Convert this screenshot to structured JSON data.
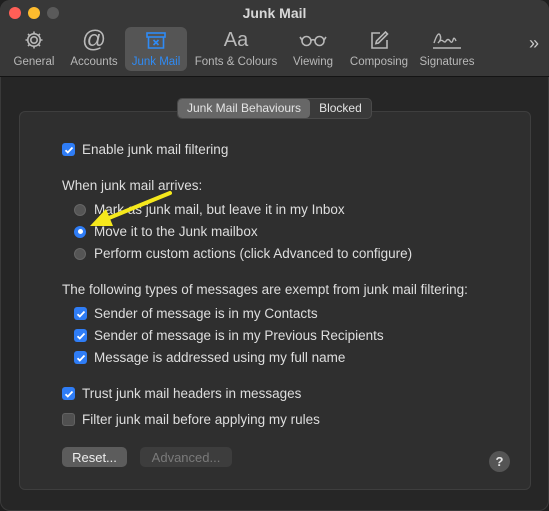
{
  "window": {
    "title": "Junk Mail"
  },
  "toolbar": {
    "tabs": [
      {
        "label": "General",
        "icon": "gear-icon"
      },
      {
        "label": "Accounts",
        "icon": "at-sign-icon"
      },
      {
        "label": "Junk Mail",
        "icon": "junk-tray-icon",
        "active": true
      },
      {
        "label": "Fonts & Colours",
        "icon": "font-aa-icon"
      },
      {
        "label": "Viewing",
        "icon": "glasses-icon"
      },
      {
        "label": "Composing",
        "icon": "compose-icon"
      },
      {
        "label": "Signatures",
        "icon": "signature-icon"
      }
    ],
    "overflow": "»"
  },
  "segmented": {
    "behaviours": "Junk Mail Behaviours",
    "blocked": "Blocked",
    "selected": "Junk Mail Behaviours"
  },
  "settings": {
    "enable_filtering": {
      "label": "Enable junk mail filtering",
      "checked": true
    },
    "arrival_heading": "When junk mail arrives:",
    "arrival_options": [
      {
        "label": "Mark as junk mail, but leave it in my Inbox",
        "selected": false
      },
      {
        "label": "Move it to the Junk mailbox",
        "selected": true
      },
      {
        "label": "Perform custom actions (click Advanced to configure)",
        "selected": false
      }
    ],
    "exempt_heading": "The following types of messages are exempt from junk mail filtering:",
    "exempt_options": [
      {
        "label": "Sender of message is in my Contacts",
        "checked": true
      },
      {
        "label": "Sender of message is in my Previous Recipients",
        "checked": true
      },
      {
        "label": "Message is addressed using my full name",
        "checked": true
      }
    ],
    "trust_headers": {
      "label": "Trust junk mail headers in messages",
      "checked": true
    },
    "filter_before_rules": {
      "label": "Filter junk mail before applying my rules",
      "checked": false
    }
  },
  "buttons": {
    "reset": "Reset...",
    "advanced": "Advanced...",
    "help": "?"
  },
  "colors": {
    "accent": "#2f7df6",
    "annotation_arrow": "#f5e81c",
    "active_tab_text": "#2f8bf5"
  }
}
